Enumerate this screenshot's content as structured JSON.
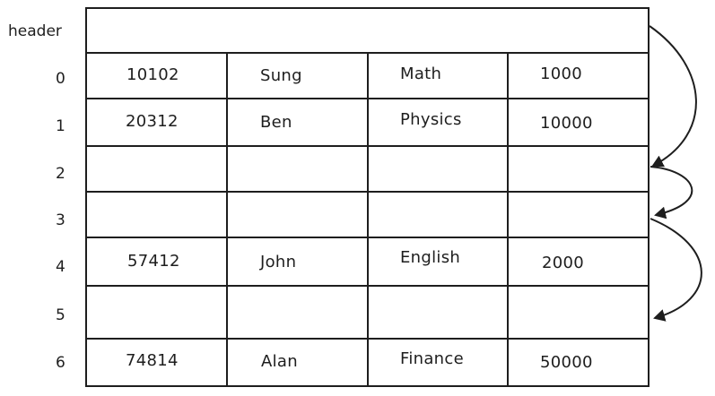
{
  "header_label": "header",
  "rows": [
    {
      "index": "0",
      "cells": [
        "10102",
        "Sung",
        "Math",
        "1000"
      ]
    },
    {
      "index": "1",
      "cells": [
        "20312",
        "Ben",
        "Physics",
        "10000"
      ]
    },
    {
      "index": "2",
      "cells": [
        "",
        "",
        "",
        ""
      ]
    },
    {
      "index": "3",
      "cells": [
        "",
        "",
        "",
        ""
      ]
    },
    {
      "index": "4",
      "cells": [
        "57412",
        "John",
        "English",
        "2000"
      ]
    },
    {
      "index": "5",
      "cells": [
        "",
        "",
        "",
        ""
      ]
    },
    {
      "index": "6",
      "cells": [
        "74814",
        "Alan",
        "Finance",
        "50000"
      ]
    }
  ],
  "stroke_color": "#1e1e1e",
  "background_color": "#ffffff"
}
